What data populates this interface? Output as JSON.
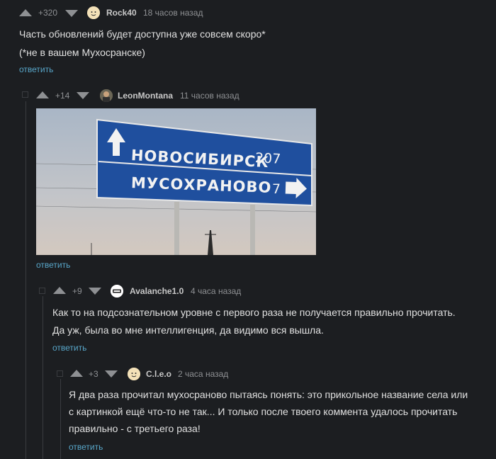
{
  "comments": [
    {
      "rating": "+320",
      "username": "Rock40",
      "time": "18 часов назад",
      "text": [
        "Часть обновлений будет доступна уже совсем скоро*",
        "(*не в вашем Мухосранске)"
      ],
      "reply": "ответить",
      "avatar_icon": "face-avatar"
    },
    {
      "rating": "+14",
      "username": "LeonMontana",
      "time": "11 часов назад",
      "reply": "ответить",
      "avatar_icon": "photo-avatar",
      "image": {
        "sign_top": "НОВОСИБИРСК",
        "sign_top_km": "207",
        "sign_bottom": "МУСОХРАНОВО",
        "sign_bottom_km": "7"
      }
    },
    {
      "rating": "+9",
      "username": "Avalanche1.0",
      "time": "4 часа назад",
      "text": [
        "Как то на подсознательном уровне с первого раза не получается правильно прочитать.",
        "Да уж, была во мне интеллигенция, да видимо вся вышла."
      ],
      "reply": "ответить",
      "avatar_icon": "logo-avatar"
    },
    {
      "rating": "+3",
      "username": "C.l.e.o",
      "time": "2 часа назад",
      "text": [
        "Я два раза прочитал мухосраново пытаясь понять: это прикольное название села или",
        "с картинкой ещё что-то не так... И только после твоего коммента удалось прочитать",
        "правильно - с третьего раза!"
      ],
      "reply": "ответить",
      "avatar_icon": "face-avatar"
    }
  ],
  "colors": {
    "background": "#1c1e21",
    "link": "#58a6c9",
    "sign_blue": "#1f4f9e"
  }
}
